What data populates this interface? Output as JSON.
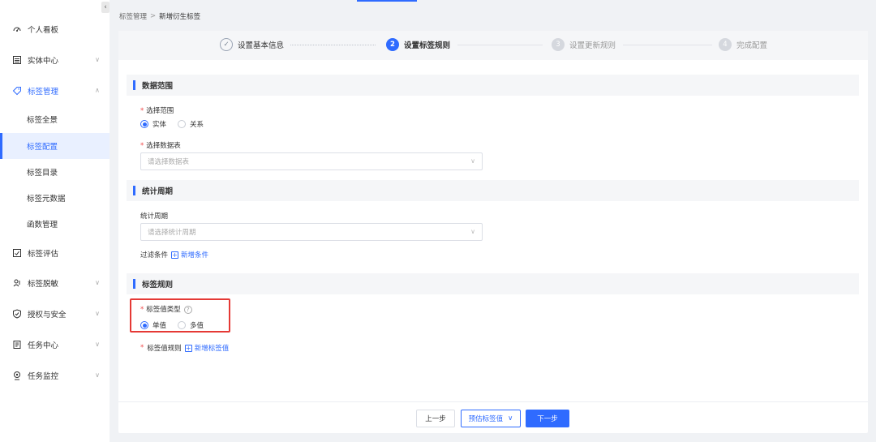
{
  "sidebar": {
    "collapse_glyph": "‹",
    "items": [
      {
        "label": "个人看板",
        "icon": "dashboard-icon"
      },
      {
        "label": "实体中心",
        "icon": "list-icon"
      },
      {
        "label": "标签管理",
        "icon": "tag-icon"
      },
      {
        "label": "标签全景"
      },
      {
        "label": "标签配置"
      },
      {
        "label": "标签目录"
      },
      {
        "label": "标签元数据"
      },
      {
        "label": "函数管理"
      },
      {
        "label": "标签评估",
        "icon": "evaluate-icon"
      },
      {
        "label": "标签脱敏",
        "icon": "mask-icon"
      },
      {
        "label": "授权与安全",
        "icon": "shield-icon"
      },
      {
        "label": "任务中心",
        "icon": "task-icon"
      },
      {
        "label": "任务监控",
        "icon": "monitor-icon"
      }
    ]
  },
  "breadcrumb": {
    "parent": "标签管理",
    "separator": ">",
    "current": "新增衍生标签"
  },
  "steps": [
    {
      "num": "✓",
      "label": "设置基本信息",
      "state": "done"
    },
    {
      "num": "2",
      "label": "设置标签规则",
      "state": "active"
    },
    {
      "num": "3",
      "label": "设置更新规则",
      "state": "pending"
    },
    {
      "num": "4",
      "label": "完成配置",
      "state": "pending"
    }
  ],
  "form": {
    "data_range": {
      "title": "数据范围",
      "scope_label": "选择范围",
      "scope_options": [
        "实体",
        "关系"
      ],
      "table_label": "选择数据表",
      "table_placeholder": "请选择数据表"
    },
    "stat_period": {
      "title": "统计周期",
      "period_label": "统计周期",
      "period_placeholder": "请选择统计周期",
      "filter_label": "过滤条件",
      "filter_add": "新增条件"
    },
    "tag_rule": {
      "title": "标签规则",
      "value_type_label": "标签值类型",
      "value_type_options": [
        "单值",
        "多值"
      ],
      "value_rule_label": "标签值规则",
      "value_rule_add": "新增标签值"
    },
    "required_mark": "*",
    "help_glyph": "?",
    "plus_glyph": "+",
    "chevron_glyph": "∨"
  },
  "footer": {
    "prev_label": "上一步",
    "estimate_label": "预估标签值",
    "next_label": "下一步"
  },
  "colors": {
    "accent": "#2f6bff",
    "highlight": "#e53935",
    "required": "#f04a4a"
  }
}
